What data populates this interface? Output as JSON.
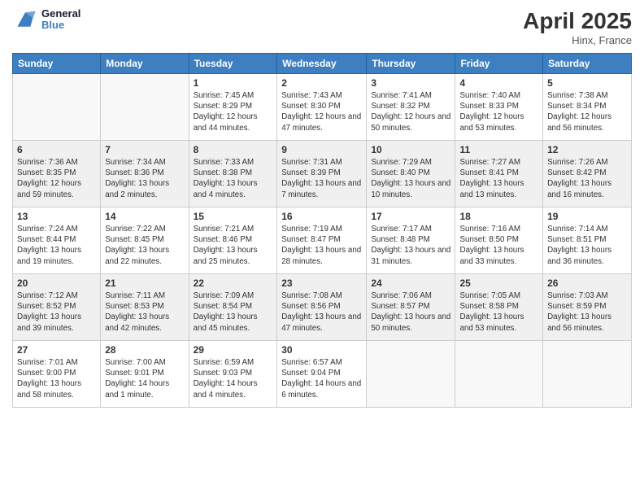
{
  "header": {
    "logo_line1": "General",
    "logo_line2": "Blue",
    "month_title": "April 2025",
    "location": "Hinx, France"
  },
  "weekdays": [
    "Sunday",
    "Monday",
    "Tuesday",
    "Wednesday",
    "Thursday",
    "Friday",
    "Saturday"
  ],
  "weeks": [
    [
      {
        "day": "",
        "info": ""
      },
      {
        "day": "",
        "info": ""
      },
      {
        "day": "1",
        "info": "Sunrise: 7:45 AM\nSunset: 8:29 PM\nDaylight: 12 hours and 44 minutes."
      },
      {
        "day": "2",
        "info": "Sunrise: 7:43 AM\nSunset: 8:30 PM\nDaylight: 12 hours and 47 minutes."
      },
      {
        "day": "3",
        "info": "Sunrise: 7:41 AM\nSunset: 8:32 PM\nDaylight: 12 hours and 50 minutes."
      },
      {
        "day": "4",
        "info": "Sunrise: 7:40 AM\nSunset: 8:33 PM\nDaylight: 12 hours and 53 minutes."
      },
      {
        "day": "5",
        "info": "Sunrise: 7:38 AM\nSunset: 8:34 PM\nDaylight: 12 hours and 56 minutes."
      }
    ],
    [
      {
        "day": "6",
        "info": "Sunrise: 7:36 AM\nSunset: 8:35 PM\nDaylight: 12 hours and 59 minutes."
      },
      {
        "day": "7",
        "info": "Sunrise: 7:34 AM\nSunset: 8:36 PM\nDaylight: 13 hours and 2 minutes."
      },
      {
        "day": "8",
        "info": "Sunrise: 7:33 AM\nSunset: 8:38 PM\nDaylight: 13 hours and 4 minutes."
      },
      {
        "day": "9",
        "info": "Sunrise: 7:31 AM\nSunset: 8:39 PM\nDaylight: 13 hours and 7 minutes."
      },
      {
        "day": "10",
        "info": "Sunrise: 7:29 AM\nSunset: 8:40 PM\nDaylight: 13 hours and 10 minutes."
      },
      {
        "day": "11",
        "info": "Sunrise: 7:27 AM\nSunset: 8:41 PM\nDaylight: 13 hours and 13 minutes."
      },
      {
        "day": "12",
        "info": "Sunrise: 7:26 AM\nSunset: 8:42 PM\nDaylight: 13 hours and 16 minutes."
      }
    ],
    [
      {
        "day": "13",
        "info": "Sunrise: 7:24 AM\nSunset: 8:44 PM\nDaylight: 13 hours and 19 minutes."
      },
      {
        "day": "14",
        "info": "Sunrise: 7:22 AM\nSunset: 8:45 PM\nDaylight: 13 hours and 22 minutes."
      },
      {
        "day": "15",
        "info": "Sunrise: 7:21 AM\nSunset: 8:46 PM\nDaylight: 13 hours and 25 minutes."
      },
      {
        "day": "16",
        "info": "Sunrise: 7:19 AM\nSunset: 8:47 PM\nDaylight: 13 hours and 28 minutes."
      },
      {
        "day": "17",
        "info": "Sunrise: 7:17 AM\nSunset: 8:48 PM\nDaylight: 13 hours and 31 minutes."
      },
      {
        "day": "18",
        "info": "Sunrise: 7:16 AM\nSunset: 8:50 PM\nDaylight: 13 hours and 33 minutes."
      },
      {
        "day": "19",
        "info": "Sunrise: 7:14 AM\nSunset: 8:51 PM\nDaylight: 13 hours and 36 minutes."
      }
    ],
    [
      {
        "day": "20",
        "info": "Sunrise: 7:12 AM\nSunset: 8:52 PM\nDaylight: 13 hours and 39 minutes."
      },
      {
        "day": "21",
        "info": "Sunrise: 7:11 AM\nSunset: 8:53 PM\nDaylight: 13 hours and 42 minutes."
      },
      {
        "day": "22",
        "info": "Sunrise: 7:09 AM\nSunset: 8:54 PM\nDaylight: 13 hours and 45 minutes."
      },
      {
        "day": "23",
        "info": "Sunrise: 7:08 AM\nSunset: 8:56 PM\nDaylight: 13 hours and 47 minutes."
      },
      {
        "day": "24",
        "info": "Sunrise: 7:06 AM\nSunset: 8:57 PM\nDaylight: 13 hours and 50 minutes."
      },
      {
        "day": "25",
        "info": "Sunrise: 7:05 AM\nSunset: 8:58 PM\nDaylight: 13 hours and 53 minutes."
      },
      {
        "day": "26",
        "info": "Sunrise: 7:03 AM\nSunset: 8:59 PM\nDaylight: 13 hours and 56 minutes."
      }
    ],
    [
      {
        "day": "27",
        "info": "Sunrise: 7:01 AM\nSunset: 9:00 PM\nDaylight: 13 hours and 58 minutes."
      },
      {
        "day": "28",
        "info": "Sunrise: 7:00 AM\nSunset: 9:01 PM\nDaylight: 14 hours and 1 minute."
      },
      {
        "day": "29",
        "info": "Sunrise: 6:59 AM\nSunset: 9:03 PM\nDaylight: 14 hours and 4 minutes."
      },
      {
        "day": "30",
        "info": "Sunrise: 6:57 AM\nSunset: 9:04 PM\nDaylight: 14 hours and 6 minutes."
      },
      {
        "day": "",
        "info": ""
      },
      {
        "day": "",
        "info": ""
      },
      {
        "day": "",
        "info": ""
      }
    ]
  ]
}
